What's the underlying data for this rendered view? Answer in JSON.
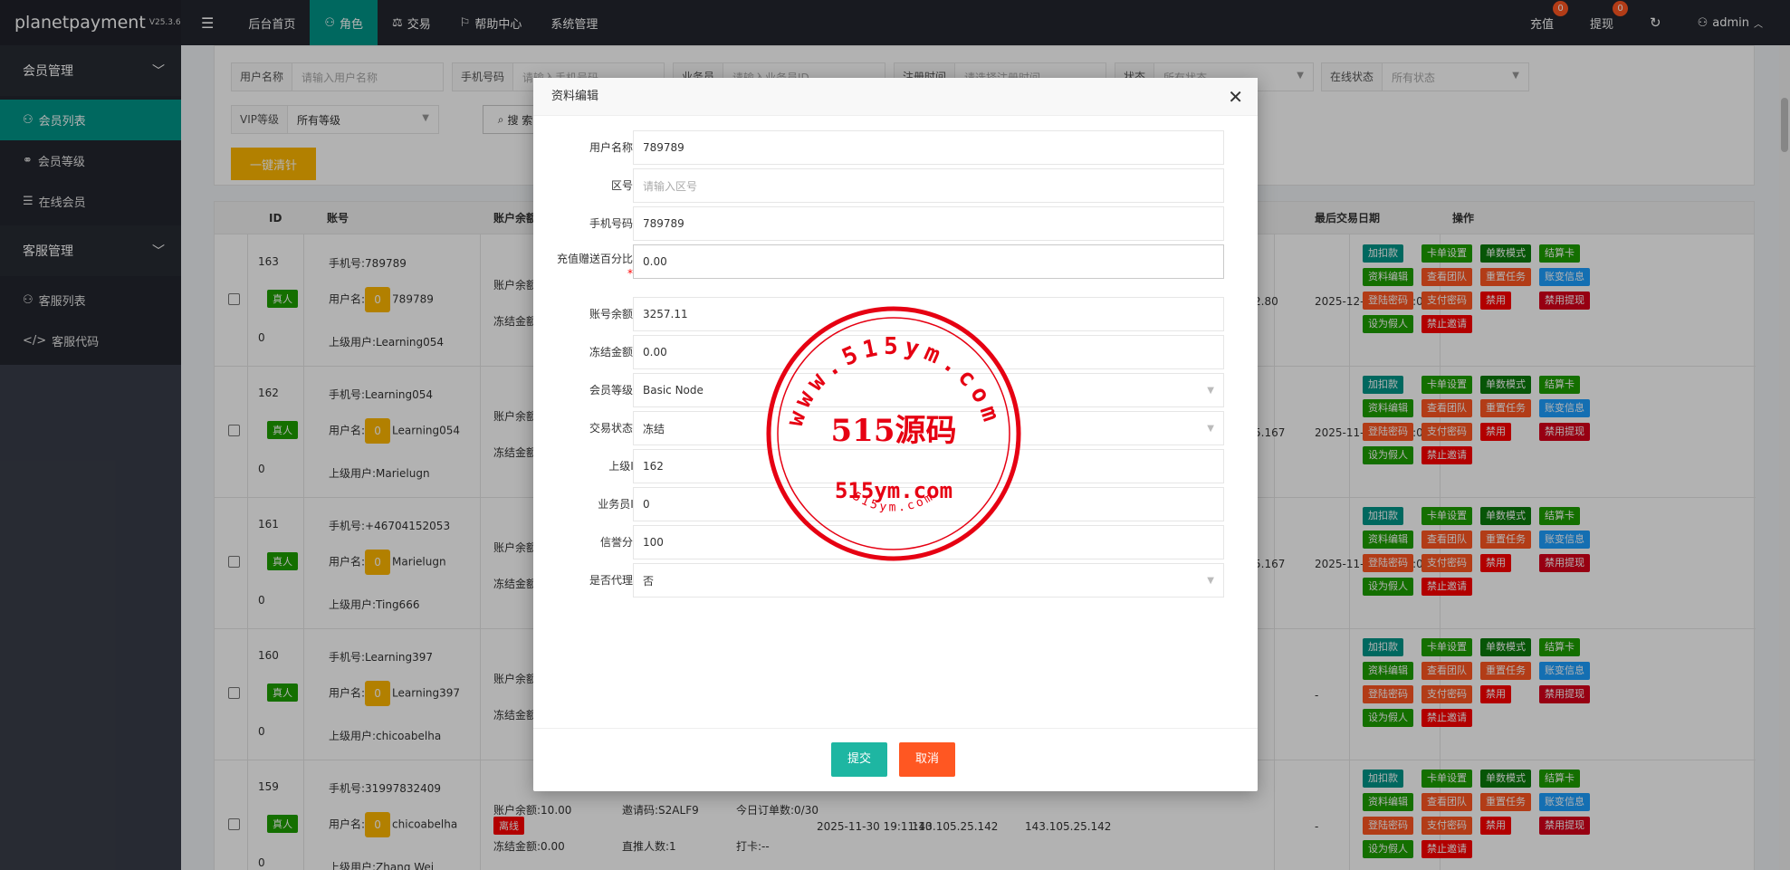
{
  "header": {
    "brand": "planetpayment",
    "version": "V25.3.6",
    "nav": [
      "后台首页",
      "角色",
      "交易",
      "帮助中心",
      "系统管理"
    ],
    "recharge": "充值",
    "recharge_count": "0",
    "withdraw": "提现",
    "withdraw_count": "0",
    "user": "admin"
  },
  "sidebar": {
    "group1": "会员管理",
    "items1": [
      "会员列表",
      "会员等级",
      "在线会员"
    ],
    "group2": "客服管理",
    "items2": [
      "客服列表",
      "客服代码"
    ]
  },
  "filter": {
    "username_label": "用户名称",
    "username_ph": "请输入用户名称",
    "phone_label": "手机号码",
    "phone_ph": "请输入手机号码",
    "salesman_label": "业务员",
    "salesman_ph": "请输入业务员ID",
    "regtime_label": "注册时间",
    "regtime_ph": "请选择注册时间",
    "status_label": "状态",
    "status_val": "所有状态",
    "online_label": "在线状态",
    "online_val": "所有状态",
    "vip_label": "VIP等级",
    "vip_val": "所有等级",
    "search": "搜 索",
    "clear": "一键清针"
  },
  "table": {
    "headers": [
      "ID",
      "账号",
      "账户余额",
      "最后交易日期",
      "操作"
    ],
    "rows": [
      {
        "id": "163",
        "phone": "手机号:789789",
        "tag": "真人",
        "vip": "0",
        "uname": "789789",
        "parent": "上级用户:Learning054",
        "zero": "0",
        "bal": "账户余额",
        "frz": "冻结金额",
        "partial": "2.80",
        "date": "2025-12-26 00:00:00"
      },
      {
        "id": "162",
        "phone": "手机号:Learning054",
        "tag": "真人",
        "vip": "0",
        "uname": "Learning054",
        "parent": "上级用户:Marielugn",
        "zero": "0",
        "bal": "账户余额",
        "frz": "冻结金额",
        "partial": "5.167",
        "date": "2025-11-30 00:00:00"
      },
      {
        "id": "161",
        "phone": "手机号:+46704152053",
        "tag": "真人",
        "vip": "0",
        "uname": "Marielugn",
        "parent": "上级用户:Ting666",
        "zero": "0",
        "bal": "账户余额",
        "frz": "冻结金额",
        "partial": "5.167",
        "date": "2025-11-30 00:00:00"
      },
      {
        "id": "160",
        "phone": "手机号:Learning397",
        "tag": "真人",
        "vip": "0",
        "uname": "Learning397",
        "parent": "上级用户:chicoabelha",
        "zero": "0",
        "bal": "账户余额",
        "frz": "冻结金额",
        "partial": "",
        "date": "-"
      },
      {
        "id": "159",
        "phone": "手机号:31997832409",
        "tag": "真人",
        "vip": "0",
        "uname": "chicoabelha",
        "parent": "上级用户:Zhang Wei",
        "zero": "0",
        "bal": "账户余额:10.00",
        "frz": "冻结金额:0.00",
        "partial": "",
        "date": "-"
      }
    ],
    "row159_extra": {
      "status": "离线",
      "invite": "邀请码:S2ALF9",
      "direct": "直推人数:1",
      "orders": "今日订单数:0/30",
      "punch": "打卡:--",
      "regtime": "2025-11-30 19:11:10",
      "ip1": "143.105.25.142",
      "ip2": "143.105.25.142"
    },
    "user_prefix": "用户名:",
    "ops": [
      "加扣款",
      "卡单设置",
      "单数模式",
      "结算卡",
      "资料编辑",
      "查看团队",
      "重置任务",
      "账变信息",
      "登陆密码",
      "支付密码",
      "禁用",
      "禁用提现",
      "设为假人",
      "禁止邀请"
    ]
  },
  "modal": {
    "title": "资料编辑",
    "fields": [
      {
        "label": "用户名称",
        "required": true,
        "value": "789789",
        "placeholder": ""
      },
      {
        "label": "区号",
        "required": true,
        "value": "",
        "placeholder": "请输入区号"
      },
      {
        "label": "手机号码",
        "required": true,
        "value": "789789",
        "placeholder": ""
      },
      {
        "label": "充值赠送百分比",
        "required": true,
        "value": "0.00",
        "placeholder": ""
      },
      {
        "label": "账号余额",
        "required": true,
        "value": "3257.11",
        "placeholder": ""
      },
      {
        "label": "冻结金额",
        "required": true,
        "value": "0.00",
        "placeholder": ""
      },
      {
        "label": "会员等级",
        "required": true,
        "value": "Basic Node",
        "placeholder": ""
      },
      {
        "label": "交易状态",
        "required": true,
        "value": "冻结",
        "placeholder": ""
      },
      {
        "label": "上级ID",
        "required": false,
        "value": "162",
        "placeholder": ""
      },
      {
        "label": "业务员ID",
        "required": false,
        "value": "0",
        "placeholder": ""
      },
      {
        "label": "信誉分",
        "required": true,
        "value": "100",
        "placeholder": ""
      },
      {
        "label": "是否代理",
        "required": true,
        "value": "否",
        "placeholder": ""
      }
    ],
    "submit": "提交",
    "cancel": "取消"
  },
  "watermark": {
    "ring_top": "www.515ym.com",
    "center": "515源码",
    "domain": "515ym.com",
    "ring_bottom": "515ym.com",
    "color": "#e60012"
  }
}
